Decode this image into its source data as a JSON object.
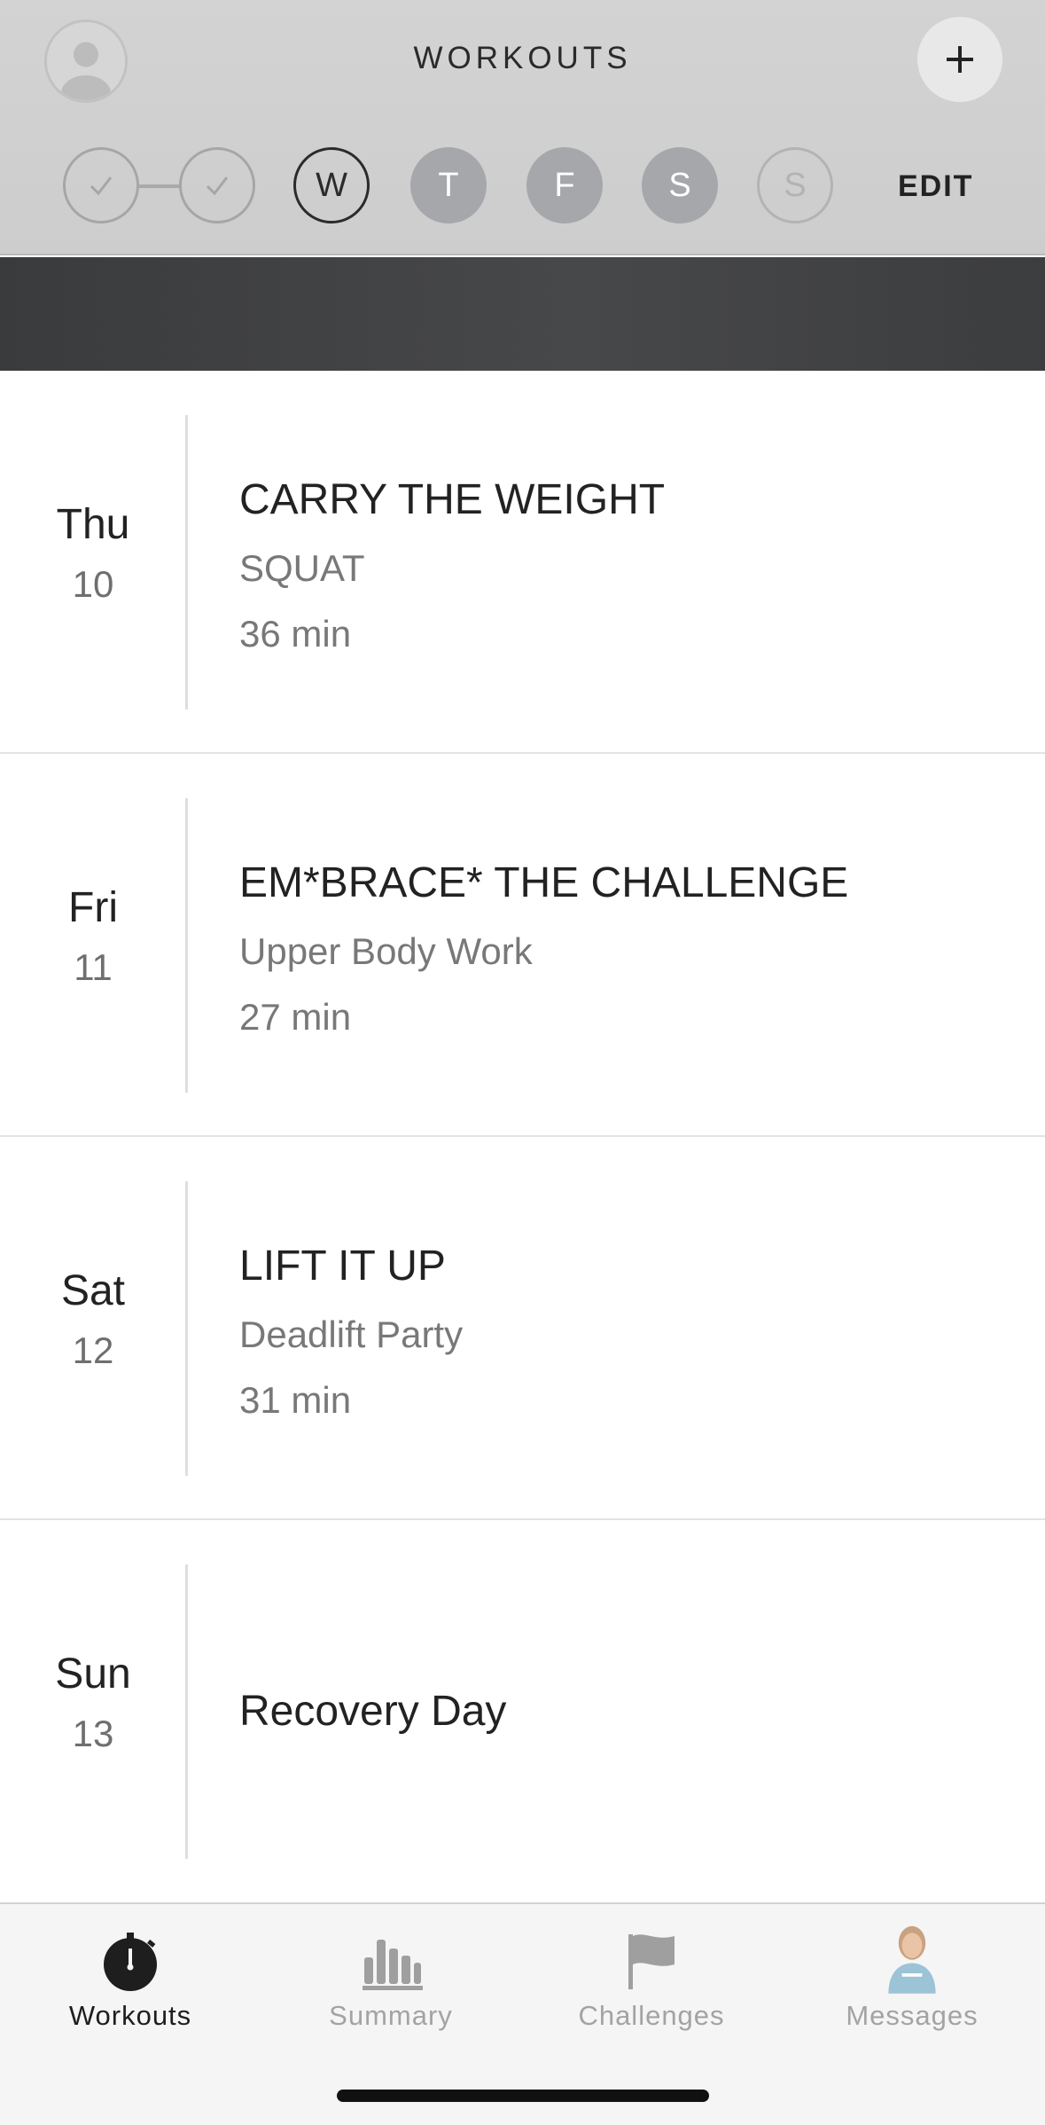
{
  "header": {
    "title": "WORKOUTS",
    "edit_label": "EDIT"
  },
  "week": [
    {
      "label": "",
      "state": "done"
    },
    {
      "label": "",
      "state": "done"
    },
    {
      "label": "W",
      "state": "current"
    },
    {
      "label": "T",
      "state": "upcoming"
    },
    {
      "label": "F",
      "state": "upcoming"
    },
    {
      "label": "S",
      "state": "upcoming"
    },
    {
      "label": "S",
      "state": "rest"
    }
  ],
  "schedule": [
    {
      "dow": "Thu",
      "day": "10",
      "name": "CARRY THE WEIGHT",
      "subtitle": "SQUAT",
      "duration": "36 min"
    },
    {
      "dow": "Fri",
      "day": "11",
      "name": "EM*BRACE* THE CHALLENGE",
      "subtitle": "Upper Body Work",
      "duration": "27 min"
    },
    {
      "dow": "Sat",
      "day": "12",
      "name": "LIFT IT UP",
      "subtitle": "Deadlift Party",
      "duration": "31 min"
    },
    {
      "dow": "Sun",
      "day": "13",
      "name": "Recovery Day",
      "subtitle": "",
      "duration": ""
    }
  ],
  "tabs": [
    {
      "label": "Workouts",
      "icon": "stopwatch-icon",
      "active": true
    },
    {
      "label": "Summary",
      "icon": "bar-chart-icon",
      "active": false
    },
    {
      "label": "Challenges",
      "icon": "flag-icon",
      "active": false
    },
    {
      "label": "Messages",
      "icon": "coach-avatar-icon",
      "active": false
    }
  ],
  "colors": {
    "header_bg": "#d1d1d1",
    "banner_bg": "#404143",
    "upcoming_day": "#a5a7aa",
    "active_tab": "#1e1e1e",
    "inactive_tab": "#a3a3a3"
  }
}
